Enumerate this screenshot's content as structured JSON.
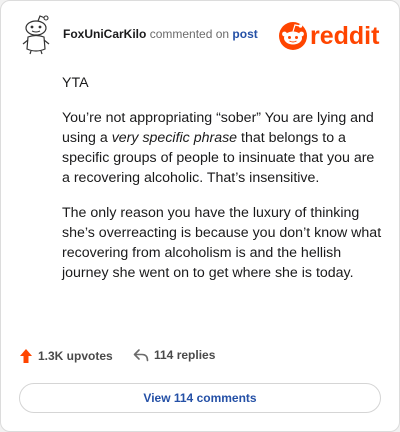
{
  "header": {
    "username": "FoxUniCarKilo",
    "action_text": "commented on",
    "post_link": "post",
    "brand": "reddit"
  },
  "comment": {
    "paragraphs": [
      {
        "text": "YTA"
      },
      {
        "before": "You’re not appropriating “sober” You are lying and using a ",
        "emphasis": "very specific phrase",
        "after": " that belongs to a specific groups of people to insinuate that you are a recovering alcoholic. That’s insensitive."
      },
      {
        "text": "The only reason you have the luxury of thinking she’s overreacting is because you don’t know what recovering from alcoholism is and the hellish journey she went on to get where she is today."
      }
    ]
  },
  "actions": {
    "upvotes": "1.3K upvotes",
    "replies": "114 replies"
  },
  "view_comments": "View 114 comments",
  "colors": {
    "brand_orange": "#ff4500",
    "link_blue": "#2450a6"
  },
  "icons": {
    "avatar": "snoo-avatar-icon",
    "upvote": "upvote-arrow-icon",
    "reply": "reply-arrow-icon"
  }
}
